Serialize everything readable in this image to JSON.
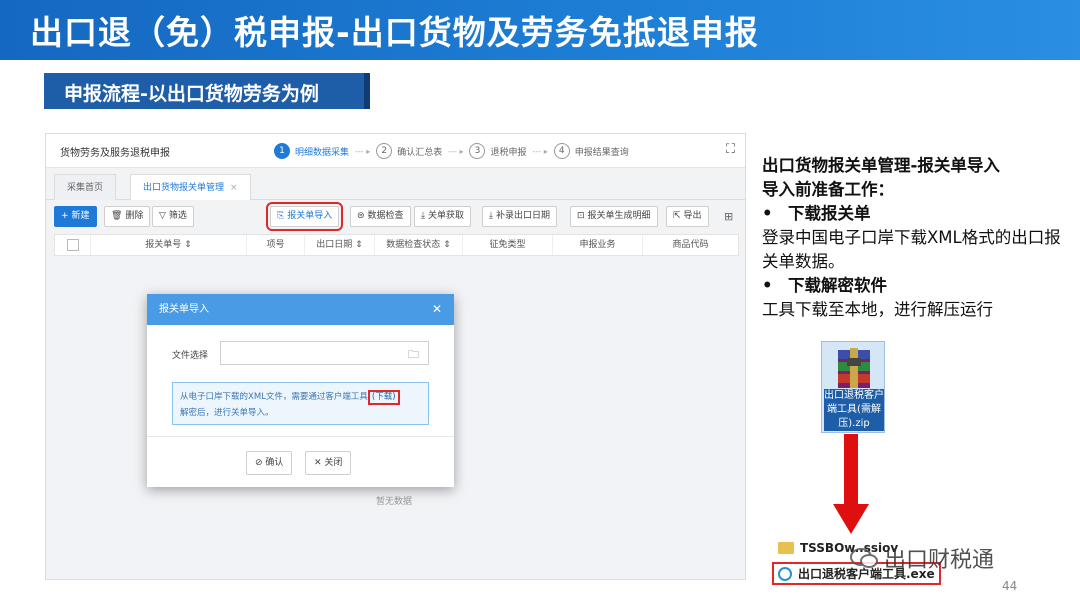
{
  "slide": {
    "title": "出口退（免）税申报-出口货物及劳务免抵退申报",
    "section": "申报流程-以出口货物劳务为例",
    "page_number": "44"
  },
  "app": {
    "title": "货物劳务及服务退税申报",
    "steps": [
      {
        "num": "1",
        "label": "明细数据采集"
      },
      {
        "num": "2",
        "label": "确认汇总表"
      },
      {
        "num": "3",
        "label": "退税申报"
      },
      {
        "num": "4",
        "label": "申报结果查询"
      }
    ],
    "tabs": [
      {
        "label": "采集首页"
      },
      {
        "label": "出口货物报关单管理"
      }
    ],
    "toolbar": {
      "new": "新建",
      "delete": "删除",
      "filter": "筛选",
      "import": "报关单导入",
      "check": "数据检查",
      "fetch": "关单获取",
      "supplement_date": "补录出口日期",
      "generate_detail": "报关单生成明细",
      "export": "导出"
    },
    "table_headers": [
      "报关单号",
      "项号",
      "出口日期",
      "数据检查状态",
      "征免类型",
      "申报业务",
      "商品代码"
    ],
    "empty_text": "暂无数据"
  },
  "modal": {
    "title": "报关单导入",
    "file_label": "文件选择",
    "file_value": "",
    "notice_text": "从电子口岸下载的XML文件，需要通过客户端工具",
    "notice_link": "下载",
    "notice_tail": "解密后，进行关单导入。",
    "confirm": "确认",
    "close": "关闭"
  },
  "notes": {
    "heading_line1": "出口货物报关单管理-报关单导入",
    "heading_line2": "导入前准备工作：",
    "bullet1_title": "下载报关单",
    "bullet1_text": "登录中国电子口岸下载XML格式的出口报关单数据。",
    "bullet2_title": "下载解密软件",
    "bullet2_text": "工具下载至本地，进行解压运行"
  },
  "files": {
    "zip_label": "出口退税客户端工具(需解压).zip",
    "folder_name": "TSSBOw..ssiov",
    "exe_name": "出口退税客户端工具.exe"
  },
  "watermark": "出口财税通",
  "colors": {
    "title_bar": "#1568c0",
    "section_tag": "#1e5ea8",
    "app_accent": "#1f7ad7",
    "highlight_red": "#e02828",
    "arrow_red": "#e00f0f"
  }
}
